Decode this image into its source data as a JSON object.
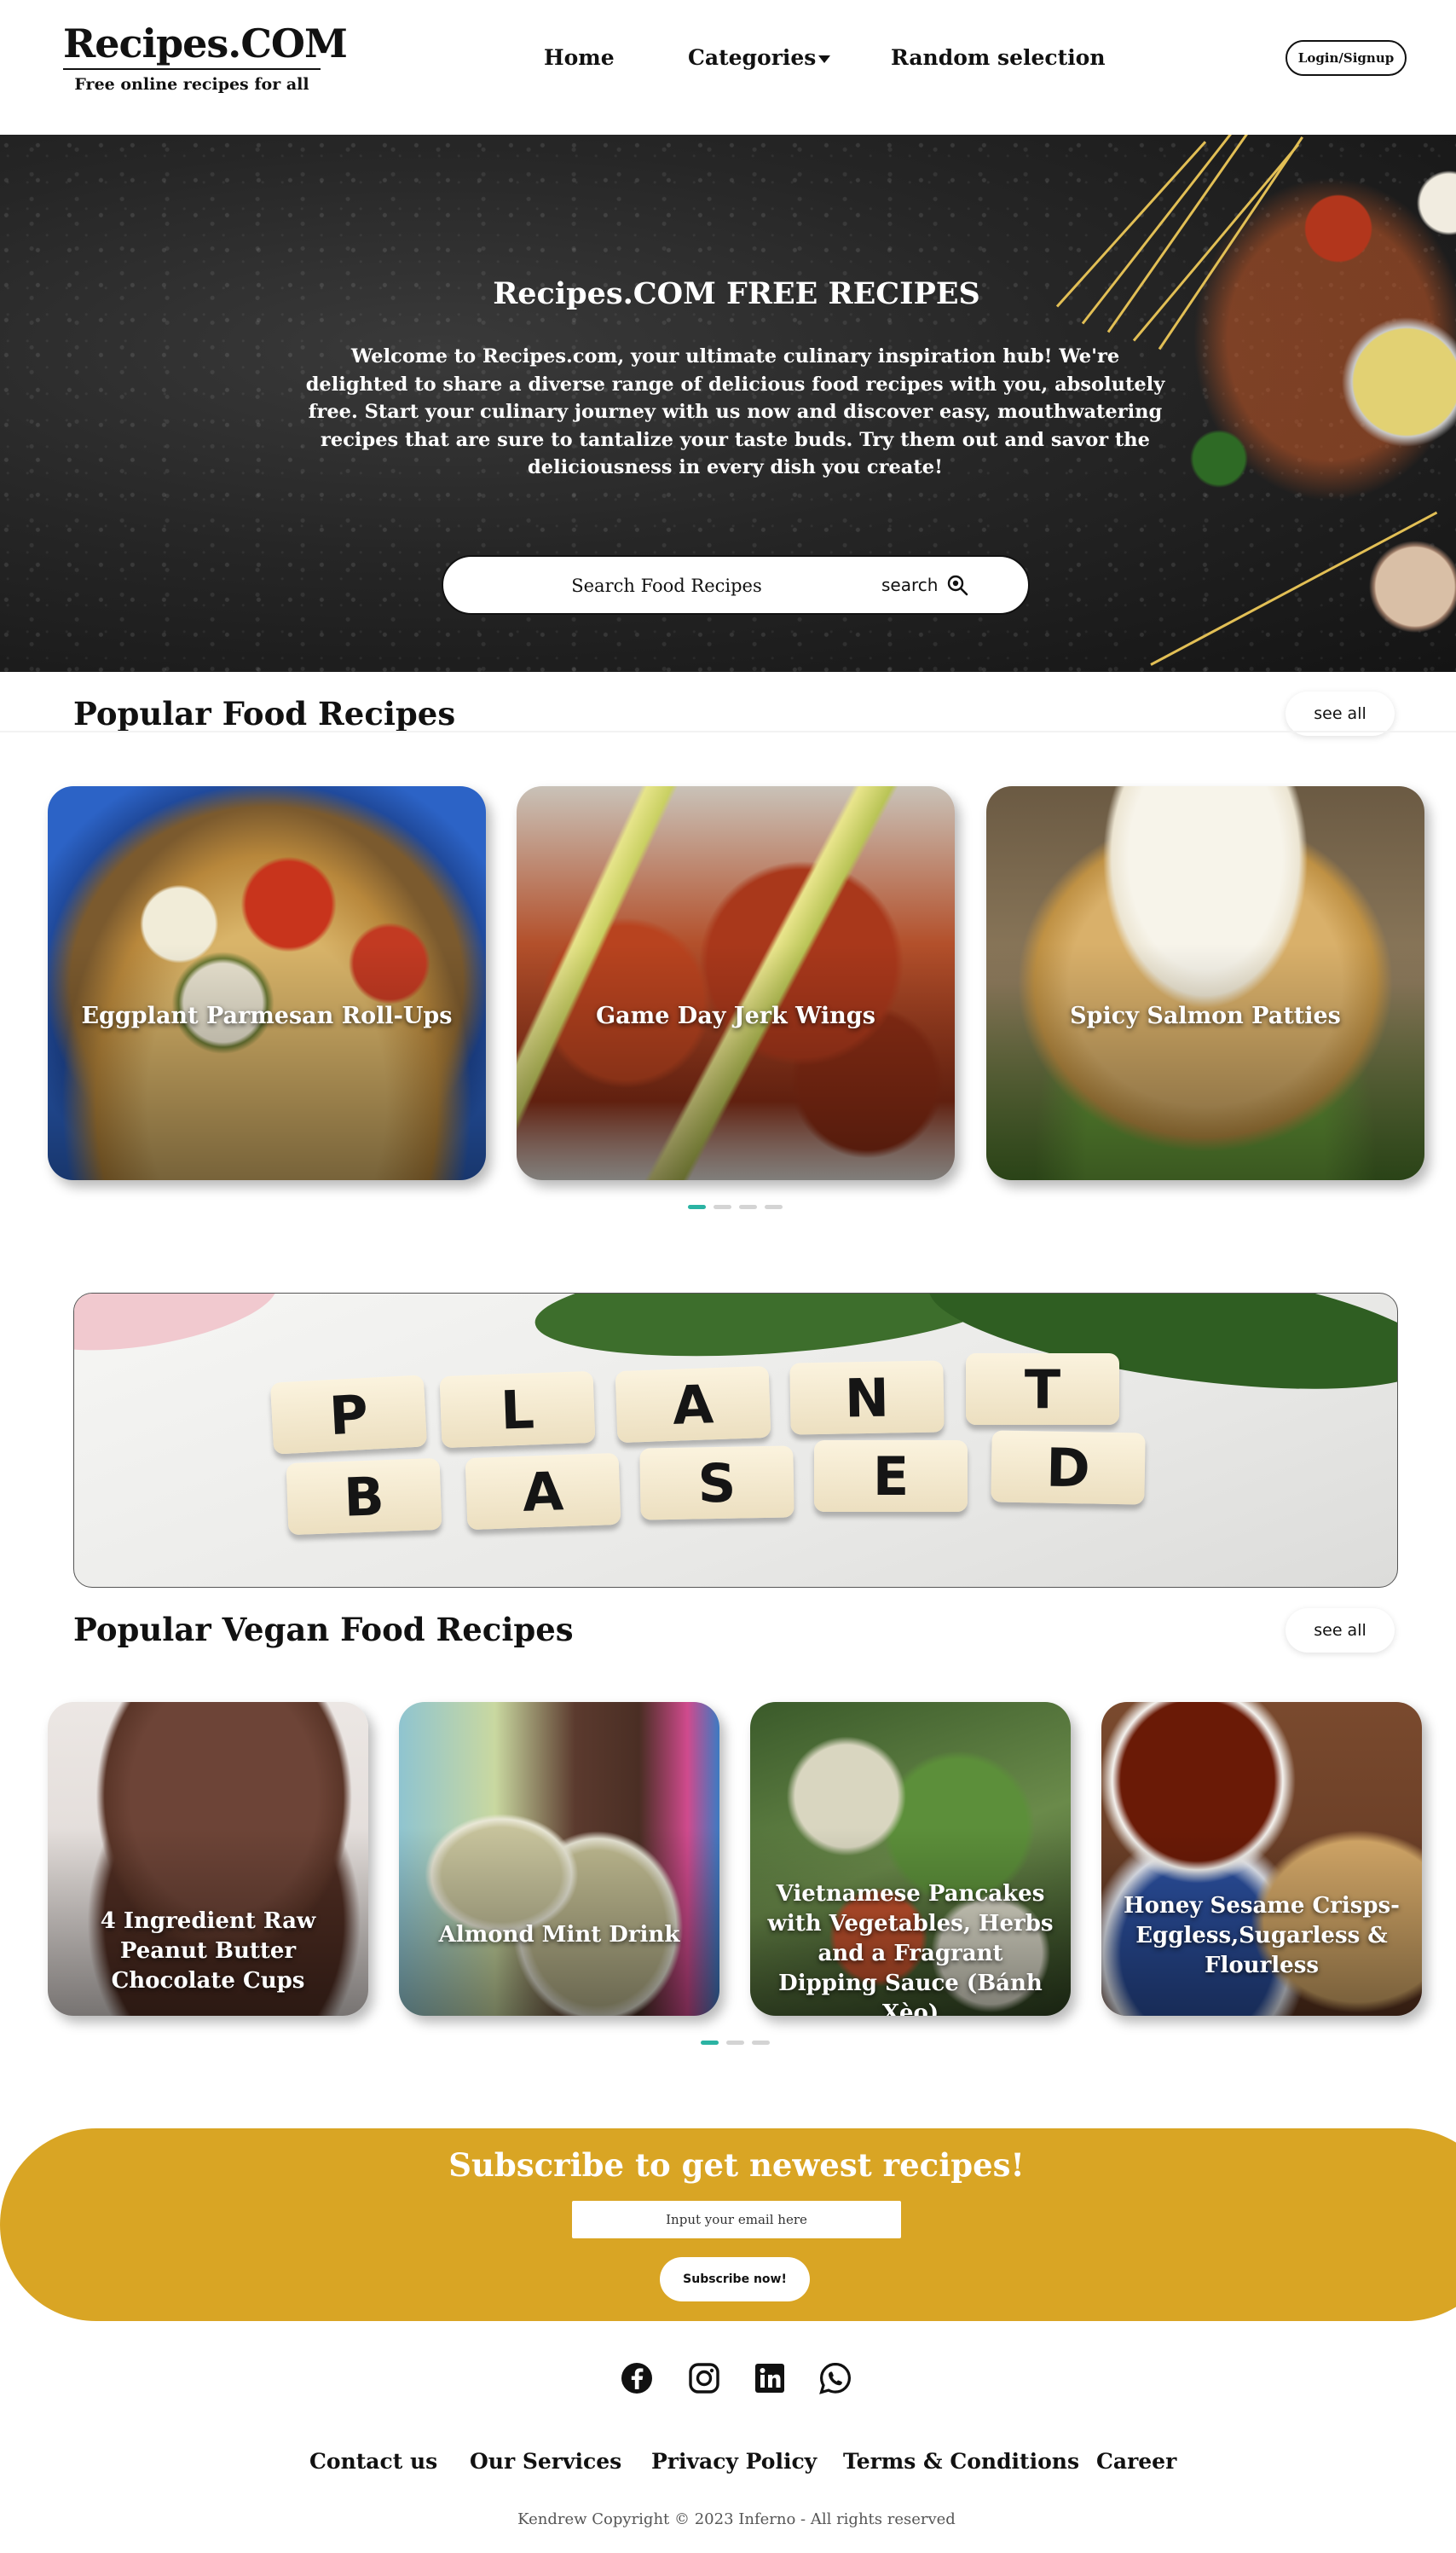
{
  "header": {
    "logo_title": "Recipes.COM",
    "logo_tagline": "Free online recipes for all",
    "nav": [
      {
        "label": "Home"
      },
      {
        "label": "Categories"
      },
      {
        "label": "Random selection"
      }
    ],
    "login_label": "Login/Signup"
  },
  "hero": {
    "title": "Recipes.COM FREE RECIPES",
    "text": "Welcome to Recipes.com, your ultimate culinary inspiration hub! We're delighted to share a diverse range of delicious food recipes with you, absolutely free. Start your culinary journey with us now and discover easy, mouthwatering recipes that are sure to tantalize your taste buds. Try them out and savor the deliciousness in every dish you create!",
    "search_placeholder": "Search Food Recipes",
    "search_button": "search"
  },
  "popular": {
    "title": "Popular Food Recipes",
    "see_all": "see all",
    "cards": [
      {
        "label": "Eggplant Parmesan Roll-Ups"
      },
      {
        "label": "Game Day Jerk Wings"
      },
      {
        "label": "Spicy Salmon Patties"
      }
    ],
    "dots": 4,
    "active_dot": 0
  },
  "banner": {
    "row1": [
      "P",
      "L",
      "A",
      "N",
      "T"
    ],
    "row2": [
      "B",
      "A",
      "S",
      "E",
      "D"
    ]
  },
  "vegan": {
    "title": "Popular Vegan Food Recipes",
    "see_all": "see all",
    "cards": [
      {
        "label": "4 Ingredient Raw Peanut Butter Chocolate Cups"
      },
      {
        "label": "Almond Mint Drink"
      },
      {
        "label": "Vietnamese Pancakes with Vegetables, Herbs and a Fragrant Dipping Sauce (Bánh Xèo)"
      },
      {
        "label": "Honey Sesame Crisps- Eggless,Sugarless & Flourless"
      }
    ],
    "dots": 3,
    "active_dot": 0
  },
  "subscribe": {
    "title": "Subscribe to get newest recipes!",
    "email_placeholder": "Input your email here",
    "button": "Subscribe now!"
  },
  "footer": {
    "social_icons": [
      "facebook-icon",
      "instagram-icon",
      "linkedin-icon",
      "whatsapp-icon"
    ],
    "links": [
      {
        "label": "Contact us"
      },
      {
        "label": "Our Services"
      },
      {
        "label": "Privacy Policy"
      },
      {
        "label": "Terms & Conditions"
      },
      {
        "label": "Career"
      }
    ],
    "copyright": "Kendrew Copyright © 2023 Inferno - All rights reserved"
  },
  "colors": {
    "accent_teal": "#2bb3a3",
    "subscribe_gold": "#d9a524"
  }
}
